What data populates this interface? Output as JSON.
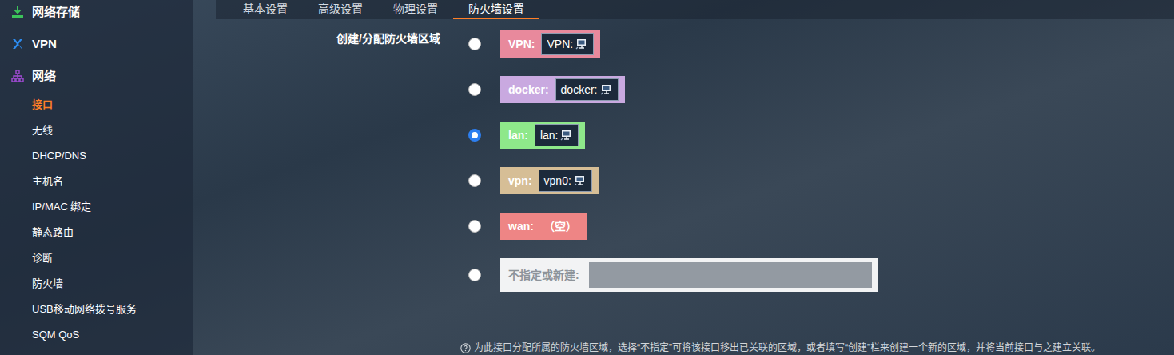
{
  "sidebar": {
    "items": [
      {
        "label": "网络存储",
        "kind": "section",
        "selected": false
      },
      {
        "label": "VPN",
        "kind": "section",
        "selected": false
      },
      {
        "label": "网络",
        "kind": "section",
        "selected": false
      },
      {
        "label": "接口",
        "kind": "sub",
        "selected": true
      },
      {
        "label": "无线",
        "kind": "sub",
        "selected": false
      },
      {
        "label": "DHCP/DNS",
        "kind": "sub",
        "selected": false
      },
      {
        "label": "主机名",
        "kind": "sub",
        "selected": false
      },
      {
        "label": "IP/MAC 绑定",
        "kind": "sub",
        "selected": false
      },
      {
        "label": "静态路由",
        "kind": "sub",
        "selected": false
      },
      {
        "label": "诊断",
        "kind": "sub",
        "selected": false
      },
      {
        "label": "防火墙",
        "kind": "sub",
        "selected": false
      },
      {
        "label": "USB移动网络拨号服务",
        "kind": "sub",
        "selected": false
      },
      {
        "label": "SQM QoS",
        "kind": "sub",
        "selected": false
      }
    ]
  },
  "tabs": [
    {
      "label": "基本设置",
      "selected": false
    },
    {
      "label": "高级设置",
      "selected": false
    },
    {
      "label": "物理设置",
      "selected": false
    },
    {
      "label": "防火墙设置",
      "selected": true
    }
  ],
  "form": {
    "label": "创建/分配防火墙区域",
    "zones": [
      {
        "name": "VPN:",
        "interface": "VPN:",
        "color": "#e8899c",
        "kind": "zone",
        "selected": false
      },
      {
        "name": "docker:",
        "interface": "docker:",
        "color": "#c9a9e0",
        "kind": "zone",
        "selected": false
      },
      {
        "name": "lan:",
        "interface": "lan:",
        "color": "#8ee88a",
        "kind": "zone",
        "selected": true
      },
      {
        "name": "vpn:",
        "interface": "vpn0:",
        "color": "#d6be96",
        "kind": "zone",
        "selected": false
      },
      {
        "name": "wan:",
        "interface": "（空）",
        "color": "#ee8585",
        "kind": "empty",
        "selected": false
      }
    ],
    "new_zone": {
      "label": "不指定或新建:",
      "value": "",
      "selected": false
    },
    "help": "为此接口分配所属的防火墙区域，选择“不指定”可将该接口移出已关联的区域，或者填写“创建”栏来创建一个新的区域，并将当前接口与之建立关联。"
  }
}
